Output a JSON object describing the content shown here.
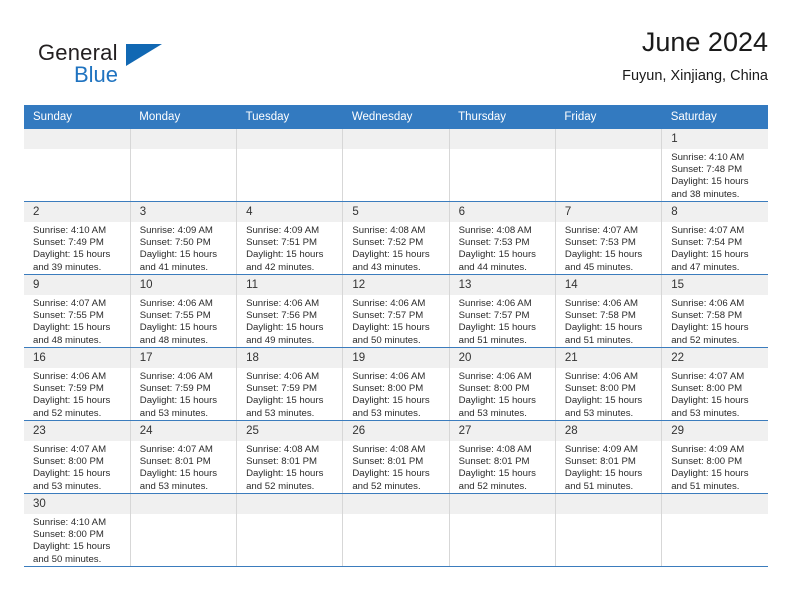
{
  "brand": {
    "name_top": "General",
    "name_bottom": "Blue",
    "accent_color": "#1168b3"
  },
  "header": {
    "title": "June 2024",
    "subtitle": "Fuyun, Xinjiang, China"
  },
  "calendar": {
    "header_bg": "#337ac0",
    "daynum_bg": "#f0f0f0",
    "weekdays": [
      "Sunday",
      "Monday",
      "Tuesday",
      "Wednesday",
      "Thursday",
      "Friday",
      "Saturday"
    ],
    "weeks": [
      [
        {
          "day": "",
          "sunrise": "",
          "sunset": "",
          "daylight": "",
          "empty": true
        },
        {
          "day": "",
          "sunrise": "",
          "sunset": "",
          "daylight": "",
          "empty": true
        },
        {
          "day": "",
          "sunrise": "",
          "sunset": "",
          "daylight": "",
          "empty": true
        },
        {
          "day": "",
          "sunrise": "",
          "sunset": "",
          "daylight": "",
          "empty": true
        },
        {
          "day": "",
          "sunrise": "",
          "sunset": "",
          "daylight": "",
          "empty": true
        },
        {
          "day": "",
          "sunrise": "",
          "sunset": "",
          "daylight": "",
          "empty": true
        },
        {
          "day": "1",
          "sunrise": "Sunrise: 4:10 AM",
          "sunset": "Sunset: 7:48 PM",
          "daylight": "Daylight: 15 hours and 38 minutes.",
          "empty": false
        }
      ],
      [
        {
          "day": "2",
          "sunrise": "Sunrise: 4:10 AM",
          "sunset": "Sunset: 7:49 PM",
          "daylight": "Daylight: 15 hours and 39 minutes.",
          "empty": false
        },
        {
          "day": "3",
          "sunrise": "Sunrise: 4:09 AM",
          "sunset": "Sunset: 7:50 PM",
          "daylight": "Daylight: 15 hours and 41 minutes.",
          "empty": false
        },
        {
          "day": "4",
          "sunrise": "Sunrise: 4:09 AM",
          "sunset": "Sunset: 7:51 PM",
          "daylight": "Daylight: 15 hours and 42 minutes.",
          "empty": false
        },
        {
          "day": "5",
          "sunrise": "Sunrise: 4:08 AM",
          "sunset": "Sunset: 7:52 PM",
          "daylight": "Daylight: 15 hours and 43 minutes.",
          "empty": false
        },
        {
          "day": "6",
          "sunrise": "Sunrise: 4:08 AM",
          "sunset": "Sunset: 7:53 PM",
          "daylight": "Daylight: 15 hours and 44 minutes.",
          "empty": false
        },
        {
          "day": "7",
          "sunrise": "Sunrise: 4:07 AM",
          "sunset": "Sunset: 7:53 PM",
          "daylight": "Daylight: 15 hours and 45 minutes.",
          "empty": false
        },
        {
          "day": "8",
          "sunrise": "Sunrise: 4:07 AM",
          "sunset": "Sunset: 7:54 PM",
          "daylight": "Daylight: 15 hours and 47 minutes.",
          "empty": false
        }
      ],
      [
        {
          "day": "9",
          "sunrise": "Sunrise: 4:07 AM",
          "sunset": "Sunset: 7:55 PM",
          "daylight": "Daylight: 15 hours and 48 minutes.",
          "empty": false
        },
        {
          "day": "10",
          "sunrise": "Sunrise: 4:06 AM",
          "sunset": "Sunset: 7:55 PM",
          "daylight": "Daylight: 15 hours and 48 minutes.",
          "empty": false
        },
        {
          "day": "11",
          "sunrise": "Sunrise: 4:06 AM",
          "sunset": "Sunset: 7:56 PM",
          "daylight": "Daylight: 15 hours and 49 minutes.",
          "empty": false
        },
        {
          "day": "12",
          "sunrise": "Sunrise: 4:06 AM",
          "sunset": "Sunset: 7:57 PM",
          "daylight": "Daylight: 15 hours and 50 minutes.",
          "empty": false
        },
        {
          "day": "13",
          "sunrise": "Sunrise: 4:06 AM",
          "sunset": "Sunset: 7:57 PM",
          "daylight": "Daylight: 15 hours and 51 minutes.",
          "empty": false
        },
        {
          "day": "14",
          "sunrise": "Sunrise: 4:06 AM",
          "sunset": "Sunset: 7:58 PM",
          "daylight": "Daylight: 15 hours and 51 minutes.",
          "empty": false
        },
        {
          "day": "15",
          "sunrise": "Sunrise: 4:06 AM",
          "sunset": "Sunset: 7:58 PM",
          "daylight": "Daylight: 15 hours and 52 minutes.",
          "empty": false
        }
      ],
      [
        {
          "day": "16",
          "sunrise": "Sunrise: 4:06 AM",
          "sunset": "Sunset: 7:59 PM",
          "daylight": "Daylight: 15 hours and 52 minutes.",
          "empty": false
        },
        {
          "day": "17",
          "sunrise": "Sunrise: 4:06 AM",
          "sunset": "Sunset: 7:59 PM",
          "daylight": "Daylight: 15 hours and 53 minutes.",
          "empty": false
        },
        {
          "day": "18",
          "sunrise": "Sunrise: 4:06 AM",
          "sunset": "Sunset: 7:59 PM",
          "daylight": "Daylight: 15 hours and 53 minutes.",
          "empty": false
        },
        {
          "day": "19",
          "sunrise": "Sunrise: 4:06 AM",
          "sunset": "Sunset: 8:00 PM",
          "daylight": "Daylight: 15 hours and 53 minutes.",
          "empty": false
        },
        {
          "day": "20",
          "sunrise": "Sunrise: 4:06 AM",
          "sunset": "Sunset: 8:00 PM",
          "daylight": "Daylight: 15 hours and 53 minutes.",
          "empty": false
        },
        {
          "day": "21",
          "sunrise": "Sunrise: 4:06 AM",
          "sunset": "Sunset: 8:00 PM",
          "daylight": "Daylight: 15 hours and 53 minutes.",
          "empty": false
        },
        {
          "day": "22",
          "sunrise": "Sunrise: 4:07 AM",
          "sunset": "Sunset: 8:00 PM",
          "daylight": "Daylight: 15 hours and 53 minutes.",
          "empty": false
        }
      ],
      [
        {
          "day": "23",
          "sunrise": "Sunrise: 4:07 AM",
          "sunset": "Sunset: 8:00 PM",
          "daylight": "Daylight: 15 hours and 53 minutes.",
          "empty": false
        },
        {
          "day": "24",
          "sunrise": "Sunrise: 4:07 AM",
          "sunset": "Sunset: 8:01 PM",
          "daylight": "Daylight: 15 hours and 53 minutes.",
          "empty": false
        },
        {
          "day": "25",
          "sunrise": "Sunrise: 4:08 AM",
          "sunset": "Sunset: 8:01 PM",
          "daylight": "Daylight: 15 hours and 52 minutes.",
          "empty": false
        },
        {
          "day": "26",
          "sunrise": "Sunrise: 4:08 AM",
          "sunset": "Sunset: 8:01 PM",
          "daylight": "Daylight: 15 hours and 52 minutes.",
          "empty": false
        },
        {
          "day": "27",
          "sunrise": "Sunrise: 4:08 AM",
          "sunset": "Sunset: 8:01 PM",
          "daylight": "Daylight: 15 hours and 52 minutes.",
          "empty": false
        },
        {
          "day": "28",
          "sunrise": "Sunrise: 4:09 AM",
          "sunset": "Sunset: 8:01 PM",
          "daylight": "Daylight: 15 hours and 51 minutes.",
          "empty": false
        },
        {
          "day": "29",
          "sunrise": "Sunrise: 4:09 AM",
          "sunset": "Sunset: 8:00 PM",
          "daylight": "Daylight: 15 hours and 51 minutes.",
          "empty": false
        }
      ],
      [
        {
          "day": "30",
          "sunrise": "Sunrise: 4:10 AM",
          "sunset": "Sunset: 8:00 PM",
          "daylight": "Daylight: 15 hours and 50 minutes.",
          "empty": false
        },
        {
          "day": "",
          "sunrise": "",
          "sunset": "",
          "daylight": "",
          "empty": true,
          "blank": true
        },
        {
          "day": "",
          "sunrise": "",
          "sunset": "",
          "daylight": "",
          "empty": true,
          "blank": true
        },
        {
          "day": "",
          "sunrise": "",
          "sunset": "",
          "daylight": "",
          "empty": true,
          "blank": true
        },
        {
          "day": "",
          "sunrise": "",
          "sunset": "",
          "daylight": "",
          "empty": true,
          "blank": true
        },
        {
          "day": "",
          "sunrise": "",
          "sunset": "",
          "daylight": "",
          "empty": true,
          "blank": true
        },
        {
          "day": "",
          "sunrise": "",
          "sunset": "",
          "daylight": "",
          "empty": true,
          "blank": true
        }
      ]
    ]
  }
}
